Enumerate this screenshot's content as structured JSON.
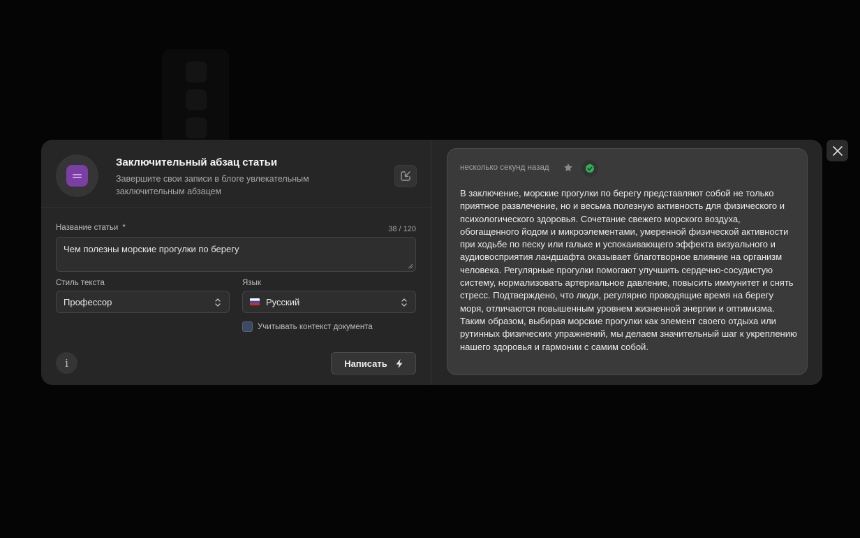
{
  "modal": {
    "title": "Заключительный абзац статьи",
    "subtitle": "Завершите свои записи в блоге увлекательным заключительным абзацем",
    "app_icon": "text-lines-icon",
    "export_icon": "export-arrow-icon"
  },
  "form": {
    "article_title": {
      "label": "Название статьи",
      "required_mark": "*",
      "counter": "38 / 120",
      "value": "Чем полезны морские прогулки по берегу"
    },
    "text_style": {
      "label": "Стиль текста",
      "selected": "Профессор"
    },
    "language": {
      "label": "Язык",
      "selected": "Русский",
      "flag": "ru-flag-icon"
    },
    "context_checkbox": {
      "label": "Учитывать контекст документа",
      "checked": false
    },
    "write_button": "Написать"
  },
  "result": {
    "timestamp": "несколько секунд назад",
    "text": "В заключение, морские прогулки по берегу представляют собой не только приятное развлечение, но и весьма полезную активность для физического и психологического здоровья. Сочетание свежего морского воздуха, обогащенного йодом и микроэлементами, умеренной физической активности при ходьбе по песку или гальке и успокаивающего эффекта визуального и аудиовосприятия ландшафта оказывает благотворное влияние на организм человека. Регулярные прогулки помогают улучшить сердечно-сосудистую систему, нормализовать артериальное давление, повысить иммунитет и снять стресс. Подтверждено, что люди, регулярно проводящие время на берегу моря, отличаются повышенным уровнем жизненной энергии и оптимизма. Таким образом, выбирая морские прогулки как элемент своего отдыха или рутинных физических упражнений, мы делаем значительный шаг к укреплению нашего здоровья и гармонии с самим собой."
  },
  "colors": {
    "accent": "#7b3fa3",
    "success": "#2fae54"
  }
}
